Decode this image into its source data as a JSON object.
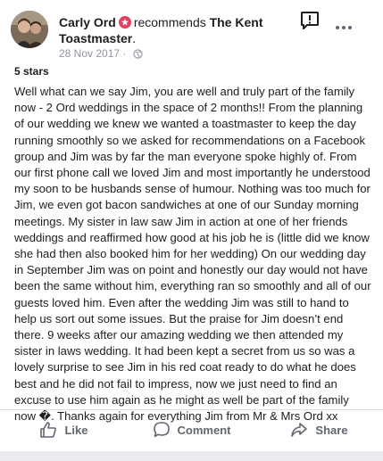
{
  "post": {
    "author": "Carly Ord",
    "action": "recommends",
    "page": "The Kent Toastmaster",
    "page_suffix": ".",
    "date": "28 Nov 2017",
    "dot": "·",
    "rating": "5 stars",
    "review": "Well what can we say Jim, you are well and truly part of the family now - 2 Ord weddings in the space of 2 months!! From the planning of our wedding we knew we wanted a toastmaster to keep the day running smoothly so we asked for recommendations on a Facebook group and Jim was by far the man everyone spoke highly of. From our first phone call we loved Jim and most importantly he understood my soon to be husbands sense of humour. Nothing was too much for Jim, we even got bacon sandwiches at one of our Sunday morning meetings. My sister in law saw Jim in action at one of her friends weddings and reaffirmed how good at his job he is (little did we know she had then also booked him for her wedding) On our wedding day in September Jim was on point and honestly our day would not have been the same without him, everything ran so smoothly and all of our guests loved him. Even after the wedding Jim was still to hand to help us sort out some issues. But the praise for Jim doesn’t end there. 9 weeks after our amazing wedding we then attended my sister in laws wedding. It had been kept a secret from us so was a lovely surprise to see Jim in his red coat ready to do what he does best and he did not fail to impress, now we just need to find an excuse to use him again as he might as well be part of the family now �. Thanks again for everything Jim from Mr & Mrs Ord xx"
  },
  "actions": {
    "like": "Like",
    "comment": "Comment",
    "share": "Share"
  },
  "icons": {
    "badge": "recommendation-badge-icon",
    "report": "report-icon",
    "more": "more-options-icon",
    "globe": "globe-icon"
  },
  "colors": {
    "badge": "#e4405f",
    "muted": "#90949c",
    "action": "#606770"
  }
}
